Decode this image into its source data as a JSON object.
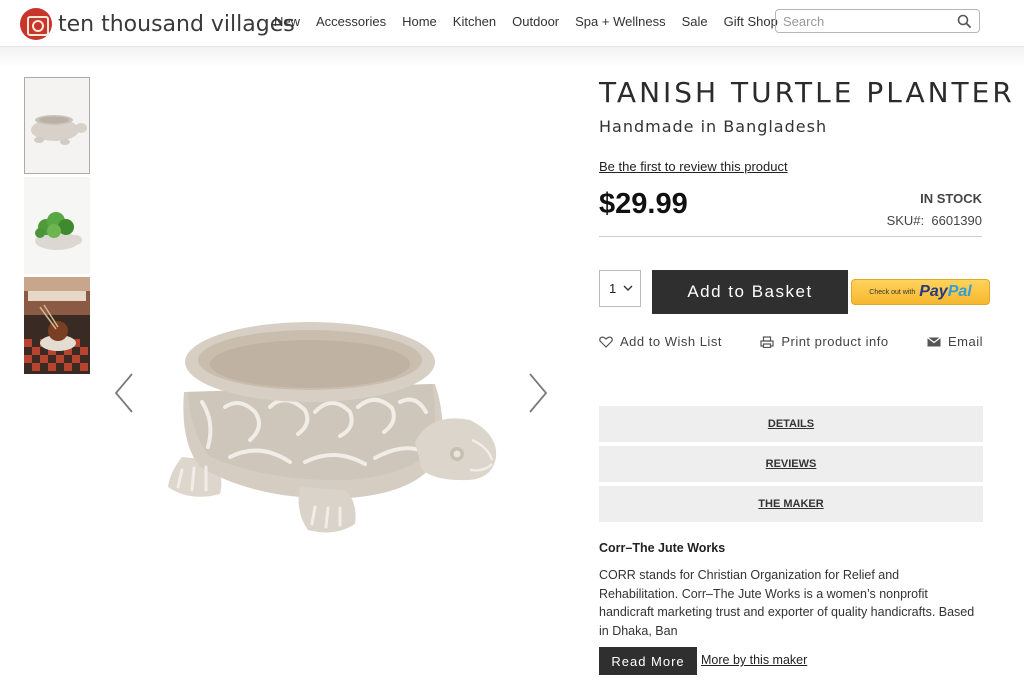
{
  "brand": {
    "name": "ten thousand villages",
    "accent": "#c8352b"
  },
  "nav": {
    "items": [
      "New",
      "Accessories",
      "Home",
      "Kitchen",
      "Outdoor",
      "Spa + Wellness",
      "Sale",
      "Gift Shop"
    ]
  },
  "search": {
    "placeholder": "Search",
    "icon": "search-icon"
  },
  "product": {
    "title": "TANISH TURTLE PLANTER",
    "subtitle": "Handmade in Bangladesh",
    "review_link": "Be the first to review this product",
    "price": "$29.99",
    "stock": "IN STOCK",
    "sku_label": "SKU#:",
    "sku": "6601390",
    "quantity": "1",
    "add_to_basket": "Add to Basket",
    "paypal_small": "Check out with",
    "paypal_pay": "Pay",
    "paypal_pal": "Pal"
  },
  "actions": {
    "wish_list": "Add to Wish List",
    "print": "Print product info",
    "email": "Email"
  },
  "tabs": {
    "details": "DETAILS",
    "reviews": "REVIEWS",
    "maker": "THE MAKER"
  },
  "maker": {
    "name": "Corr–The Jute Works",
    "description": "CORR stands for Christian Organization for Relief and Rehabilitation. Corr–The Jute Works is a women’s nonprofit handicraft marketing trust and exporter of quality handicrafts. Based in Dhaka, Ban",
    "read_more": "Read More",
    "more_link": "More by this maker"
  },
  "colors": {
    "button_dark": "#2f2f2f",
    "tab_bg": "#eeeeee",
    "paypal_yellow": "#ffc439"
  }
}
